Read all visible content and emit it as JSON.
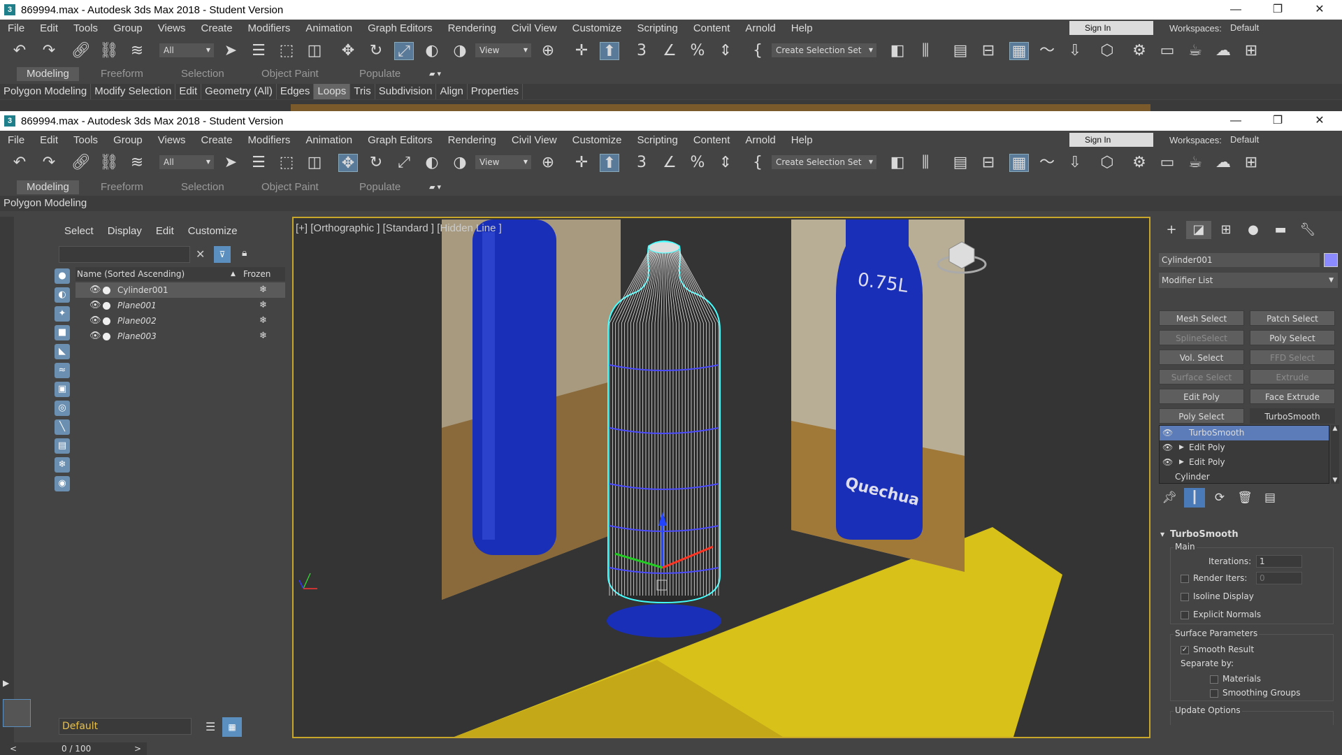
{
  "window_back": {
    "title": "869994.max - Autodesk 3ds Max 2018 - Student Version",
    "ribbon_sub_items": [
      "Polygon Modeling",
      "Modify Selection",
      "Edit",
      "Geometry (All)",
      "Edges",
      "Loops",
      "Tris",
      "Subdivision",
      "Align",
      "Properties"
    ],
    "active_sub": "Loops"
  },
  "window": {
    "title": "869994.max - Autodesk 3ds Max 2018 - Student Version",
    "controls": {
      "minimize": "—",
      "restore": "❐",
      "close": "✕"
    }
  },
  "menu": [
    "File",
    "Edit",
    "Tools",
    "Group",
    "Views",
    "Create",
    "Modifiers",
    "Animation",
    "Graph Editors",
    "Rendering",
    "Civil View",
    "Customize",
    "Scripting",
    "Content",
    "Arnold",
    "Help"
  ],
  "account": {
    "sign_in": "Sign In",
    "workspaces_label": "Workspaces:",
    "workspace": "Default"
  },
  "toolbar": {
    "selection_filter": "All",
    "ref_coord": "View",
    "selection_set": "Create Selection Set"
  },
  "ribbon": {
    "tabs": [
      "Modeling",
      "Freeform",
      "Selection",
      "Object Paint",
      "Populate"
    ],
    "active_tab": "Modeling",
    "sub_label": "Polygon Modeling"
  },
  "explorer": {
    "menu": [
      "Select",
      "Display",
      "Edit",
      "Customize"
    ],
    "col_name": "Name (Sorted Ascending)",
    "col_frozen": "Frozen",
    "rows": [
      {
        "name": "Cylinder001",
        "selected": true
      },
      {
        "name": "Plane001",
        "selected": false
      },
      {
        "name": "Plane002",
        "selected": false
      },
      {
        "name": "Plane003",
        "selected": false
      }
    ],
    "layer": "Default",
    "time": "0 / 100"
  },
  "viewport": {
    "label": "[+] [Orthographic ] [Standard ] [Hidden Line ]",
    "bottle_text_size": "0.75L",
    "bottle_text_brand": "Quechua"
  },
  "command_panel": {
    "object_name": "Cylinder001",
    "object_color": "#8b8bff",
    "modifier_list": "Modifier List",
    "buttons": [
      {
        "label": "Mesh Select",
        "state": "normal"
      },
      {
        "label": "Patch Select",
        "state": "normal"
      },
      {
        "label": "SplineSelect",
        "state": "disabled"
      },
      {
        "label": "Poly Select",
        "state": "normal"
      },
      {
        "label": "Vol. Select",
        "state": "normal"
      },
      {
        "label": "FFD Select",
        "state": "disabled"
      },
      {
        "label": "Surface Select",
        "state": "disabled"
      },
      {
        "label": "Extrude",
        "state": "disabled"
      },
      {
        "label": "Edit Poly",
        "state": "normal"
      },
      {
        "label": "Face Extrude",
        "state": "normal"
      },
      {
        "label": "Poly Select",
        "state": "normal"
      },
      {
        "label": "TurboSmooth",
        "state": "active"
      }
    ],
    "stack": [
      {
        "name": "TurboSmooth",
        "selected": true,
        "expandable": false,
        "eye": true
      },
      {
        "name": "Edit Poly",
        "selected": false,
        "expandable": true,
        "eye": true
      },
      {
        "name": "Edit Poly",
        "selected": false,
        "expandable": true,
        "eye": true
      },
      {
        "name": "Cylinder",
        "selected": false,
        "expandable": false,
        "eye": false
      }
    ],
    "rollout": {
      "title": "TurboSmooth",
      "main_group": "Main",
      "iterations_label": "Iterations:",
      "iterations_value": "1",
      "render_iters_label": "Render Iters:",
      "render_iters_value": "0",
      "isoline": "Isoline Display",
      "explicit_normals": "Explicit Normals",
      "surface_group": "Surface Parameters",
      "smooth_result": "Smooth Result",
      "separate_by": "Separate by:",
      "materials": "Materials",
      "smoothing_groups": "Smoothing Groups",
      "update_options": "Update Options"
    }
  },
  "colors": {
    "accent": "#c8a62a",
    "selection": "#5b7cb8",
    "bottle_blue": "#1a2fb8",
    "floor_yellow": "#d8c21a"
  }
}
